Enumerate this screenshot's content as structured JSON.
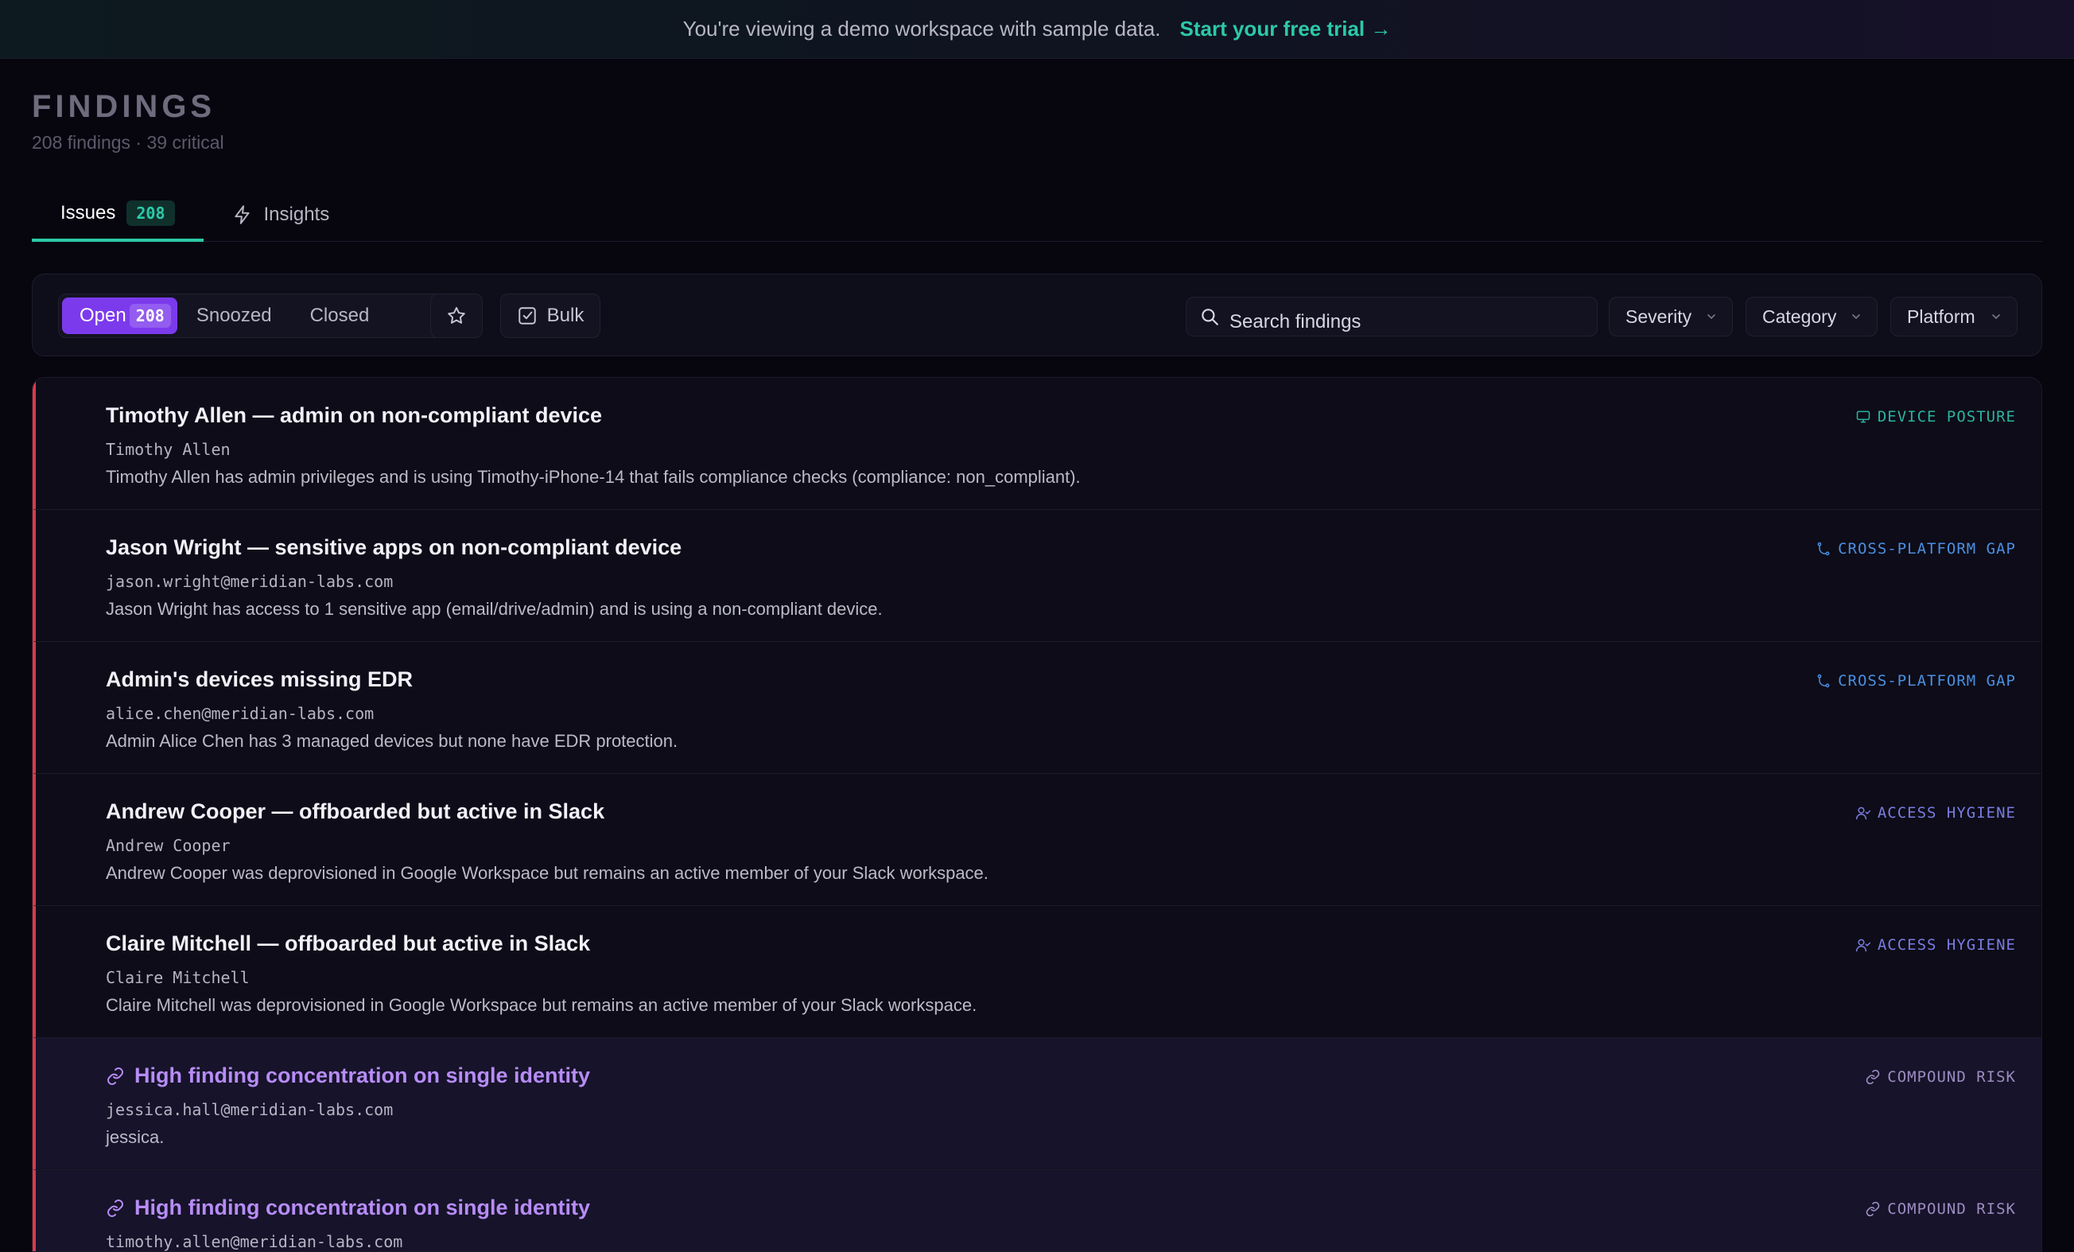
{
  "banner": {
    "message": "You're viewing a demo workspace with sample data.",
    "cta": "Start your free trial →"
  },
  "header": {
    "title": "FINDINGS",
    "subtitle": "208 findings · 39 critical"
  },
  "tabs": [
    {
      "label": "Issues",
      "badge": "208",
      "active": true
    },
    {
      "label": "Insights",
      "icon": "bolt-icon"
    }
  ],
  "filters": {
    "status": [
      {
        "label": "Open",
        "count": "208",
        "active": true
      },
      {
        "label": "Snoozed"
      },
      {
        "label": "Closed"
      }
    ],
    "bulk_label": "Bulk",
    "search_placeholder": "Search findings",
    "dropdowns": {
      "severity": "Severity",
      "category": "Category",
      "platform": "Platform"
    }
  },
  "colors": {
    "accent": "#2cc9a8",
    "primary": "#7c3aed",
    "critical": "#d93a4a",
    "compound": "#b78cf7"
  },
  "findings": [
    {
      "title": "Timothy Allen — admin on non-compliant device",
      "subject": "Timothy Allen",
      "description": "Timothy Allen has admin privileges and is using Timothy-iPhone-14 that fails compliance checks (compliance: non_compliant).",
      "category": "DEVICE POSTURE"
    },
    {
      "title": "Jason Wright — sensitive apps on non-compliant device",
      "subject": "jason.wright@meridian-labs.com",
      "description": "Jason Wright has access to 1 sensitive app (email/drive/admin) and is using a non-compliant device.",
      "category": "CROSS-PLATFORM GAP"
    },
    {
      "title": "Admin's devices missing EDR",
      "subject": "alice.chen@meridian-labs.com",
      "description": "Admin Alice Chen has 3 managed devices but none have EDR protection.",
      "category": "CROSS-PLATFORM GAP"
    },
    {
      "title": "Andrew Cooper — offboarded but active in Slack",
      "subject": "Andrew Cooper",
      "description": "Andrew Cooper was deprovisioned in Google Workspace but remains an active member of your Slack workspace.",
      "category": "ACCESS HYGIENE"
    },
    {
      "title": "Claire Mitchell — offboarded but active in Slack",
      "subject": "Claire Mitchell",
      "description": "Claire Mitchell was deprovisioned in Google Workspace but remains an active member of your Slack workspace.",
      "category": "ACCESS HYGIENE"
    },
    {
      "title": "High finding concentration on single identity",
      "subject": "jessica.hall@meridian-labs.com",
      "description": "jessica.",
      "category": "COMPOUND RISK"
    },
    {
      "title": "High finding concentration on single identity",
      "subject": "timothy.allen@meridian-labs.com",
      "description": "",
      "category": "COMPOUND RISK"
    }
  ]
}
